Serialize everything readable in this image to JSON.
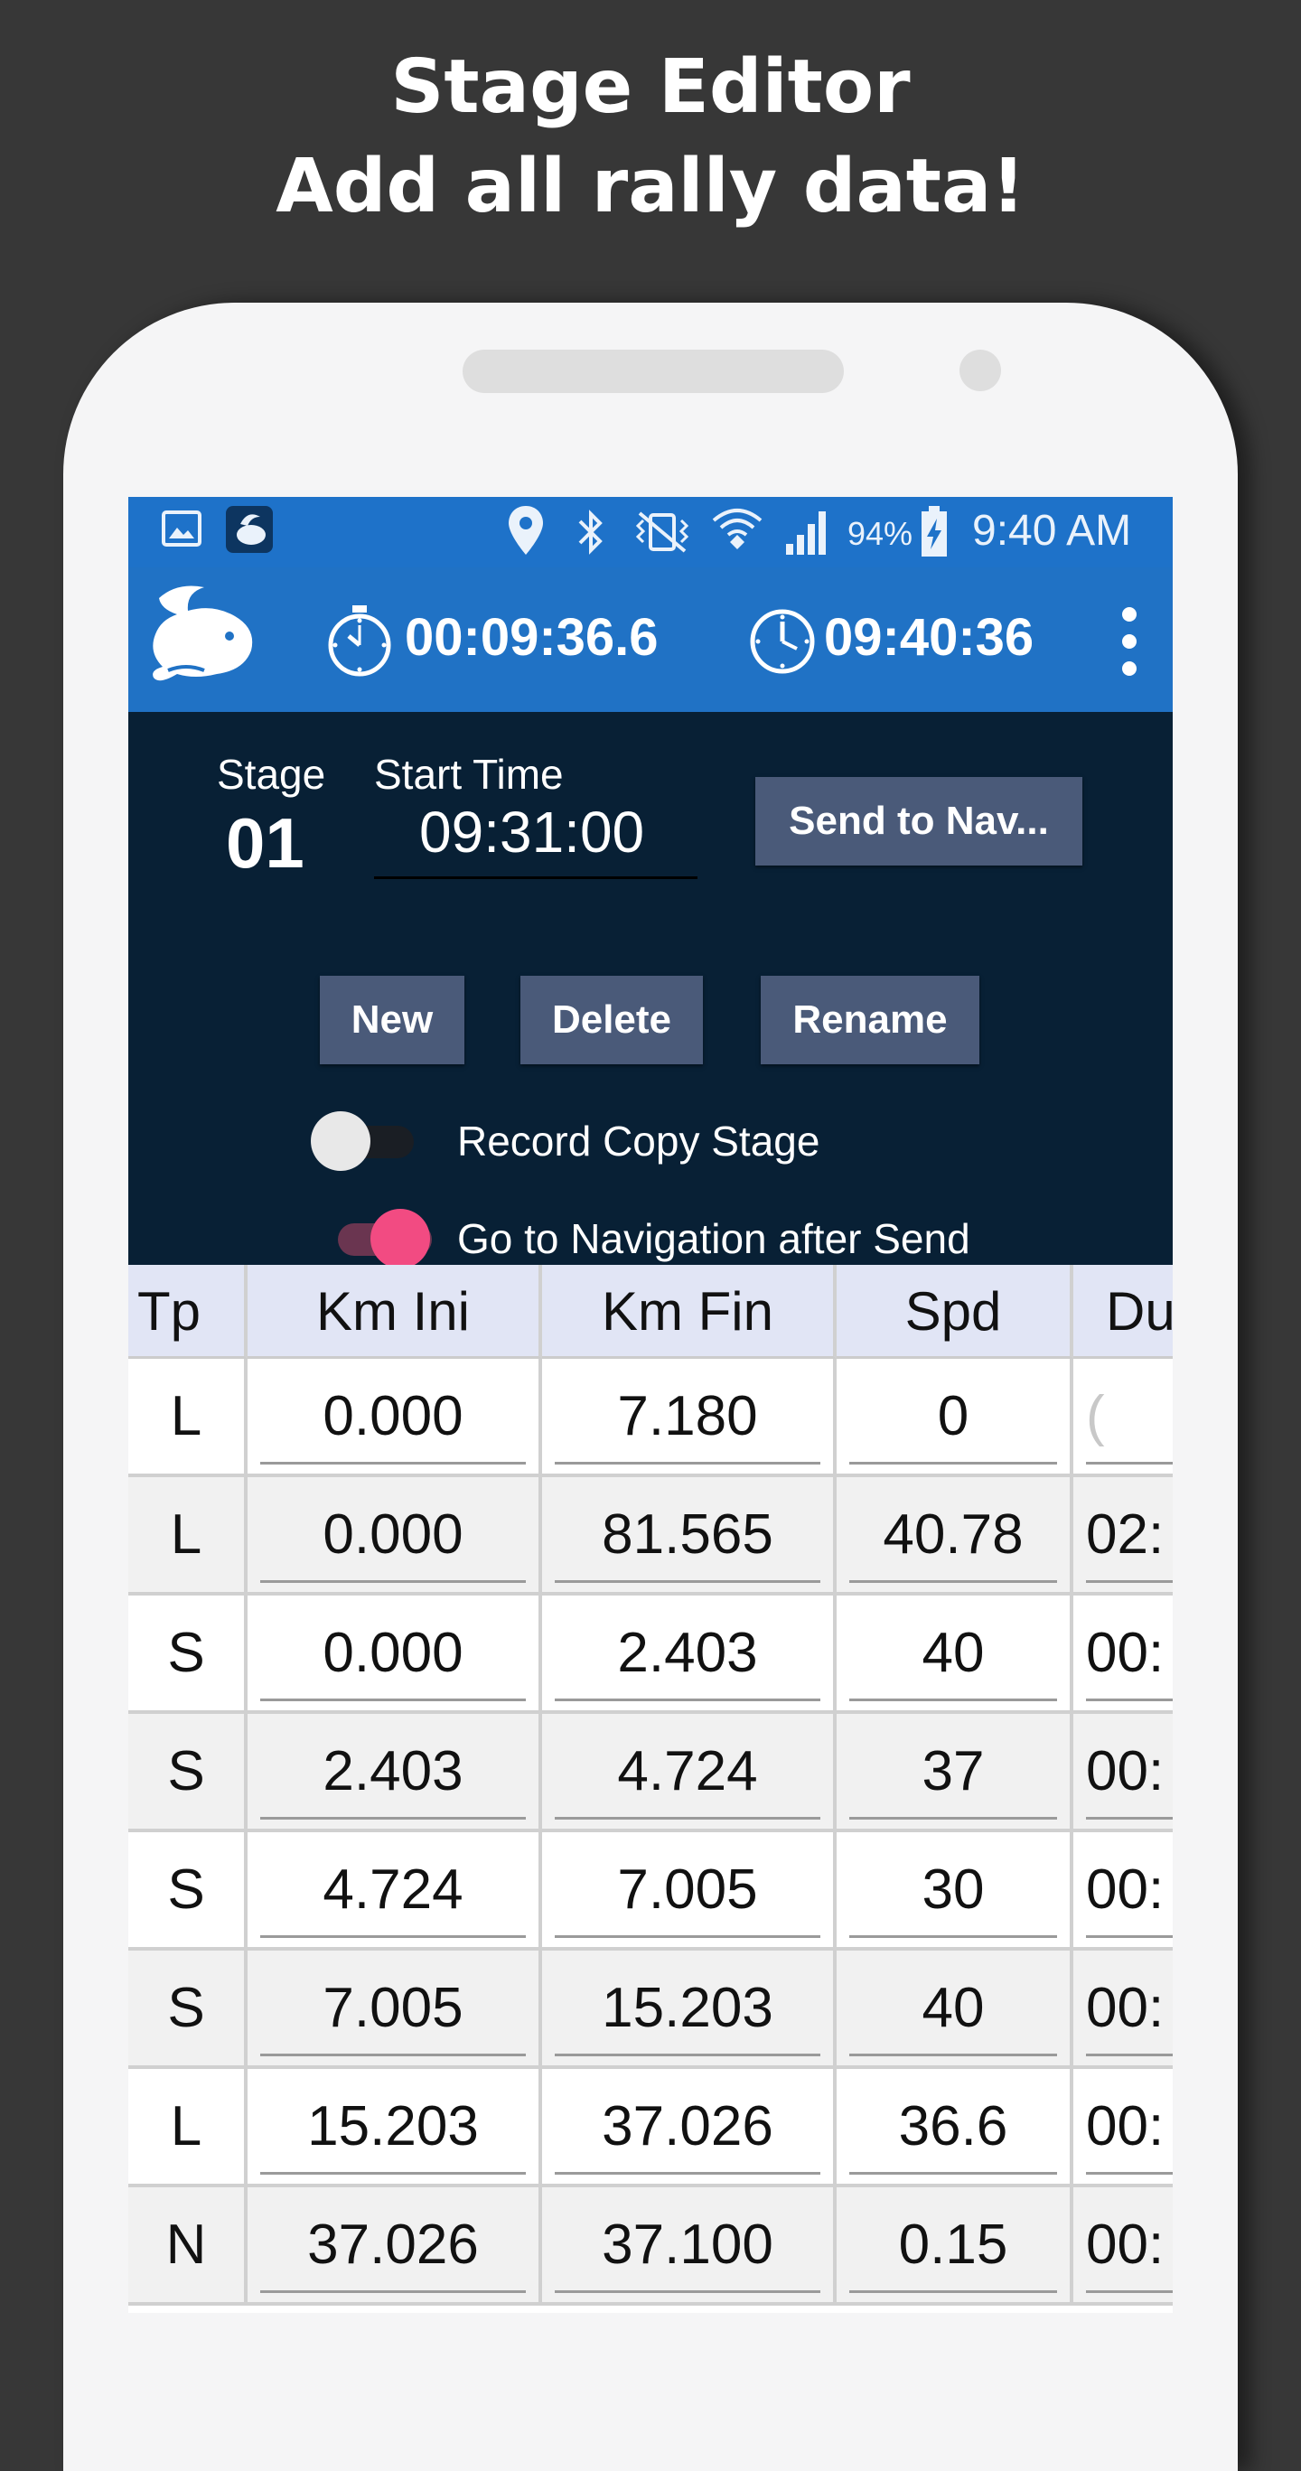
{
  "promo": {
    "line1": "Stage Editor",
    "line2": "Add all rally data!"
  },
  "status_bar": {
    "icons": [
      "image-icon",
      "app-notification-icon",
      "location-icon",
      "bluetooth-icon",
      "vibrate-icon",
      "wifi-icon",
      "signal-icon",
      "battery-charging-icon"
    ],
    "battery": "94%",
    "time": "9:40 AM"
  },
  "app_bar": {
    "logo": "rabbit-logo",
    "stopwatch": "00:09:36.6",
    "clock": "09:40:36",
    "menu_icon": "more-vert-icon"
  },
  "stage_panel": {
    "stage_label": "Stage",
    "stage_number": "01",
    "start_time_label": "Start Time",
    "start_time_value": "09:31:00",
    "send_button": "Send to Nav...",
    "new_button": "New",
    "delete_button": "Delete",
    "rename_button": "Rename",
    "record_copy": {
      "label": "Record Copy Stage",
      "on": false
    },
    "go_nav": {
      "label": "Go to Navigation after Send",
      "on": true
    }
  },
  "colors": {
    "status_bar": "#1e72c9",
    "app_bar": "#2072c5",
    "panel": "#082035",
    "button": "#4a5a79",
    "toggle_on": "#f24b82",
    "header_row": "#e1e5f5"
  },
  "table": {
    "headers": [
      "Tp",
      "Km Ini",
      "Km Fin",
      "Spd",
      "Du"
    ],
    "rows": [
      {
        "tp": "L",
        "km_ini": "0.000",
        "km_fin": "7.180",
        "spd": "0",
        "du": "("
      },
      {
        "tp": "L",
        "km_ini": "0.000",
        "km_fin": "81.565",
        "spd": "40.78",
        "du": "02:"
      },
      {
        "tp": "S",
        "km_ini": "0.000",
        "km_fin": "2.403",
        "spd": "40",
        "du": "00:"
      },
      {
        "tp": "S",
        "km_ini": "2.403",
        "km_fin": "4.724",
        "spd": "37",
        "du": "00:"
      },
      {
        "tp": "S",
        "km_ini": "4.724",
        "km_fin": "7.005",
        "spd": "30",
        "du": "00:"
      },
      {
        "tp": "S",
        "km_ini": "7.005",
        "km_fin": "15.203",
        "spd": "40",
        "du": "00:"
      },
      {
        "tp": "L",
        "km_ini": "15.203",
        "km_fin": "37.026",
        "spd": "36.6",
        "du": "00:"
      },
      {
        "tp": "N",
        "km_ini": "37.026",
        "km_fin": "37.100",
        "spd": "0.15",
        "du": "00:"
      }
    ]
  }
}
